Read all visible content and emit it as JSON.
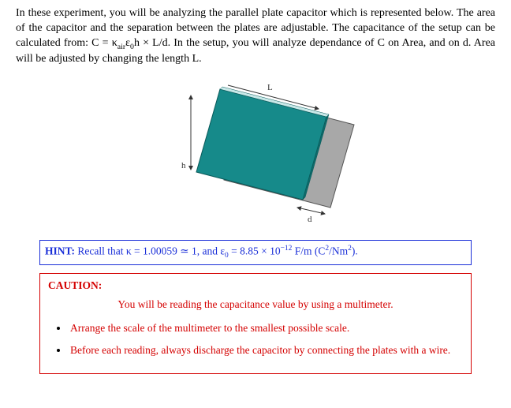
{
  "intro": {
    "text": "In these experiment, you will be analyzing the parallel plate capacitor which is represented below. The area of the capacitor and the separation between the plates are adjustable. The capacitance of the setup can be calculated from: C = κairε0h × L/d. In the setup, you will analyze dependance of C on Area, and on d. Area will be adjusted by changing the length L.",
    "part1": "In these experiment, you will be analyzing the parallel plate capacitor which is represented below. The area of the capacitor and the separation between the plates are adjustable. The capacitance of the setup can be calculated from: ",
    "formula_C": "C",
    "formula_eq": " = κ",
    "formula_air": "air",
    "formula_eps": "ε",
    "formula_0": "0",
    "formula_rest": "h × L/d",
    "part2": ". In the setup, you will analyze dependance of C on Area, and on d. Area will be adjusted by changing the length L."
  },
  "diagram": {
    "label_L": "L",
    "label_h": "h",
    "label_d": "d"
  },
  "hint": {
    "label": "HINT:",
    "pre": " Recall that κ = 1.00059 ≃ 1, and ε",
    "sub0": "0",
    "mid": " = 8.85 × 10",
    "sup": "−12",
    "post1": " F/m (C",
    "sup2": "2",
    "post2": "/Nm",
    "sup3": "2",
    "post3": ")."
  },
  "caution": {
    "title": "CAUTION:",
    "center": "You will be reading the capacitance value by using a multimeter.",
    "item1": "Arrange the scale of the multimeter to the smallest possible scale.",
    "item2": "Before each reading, always discharge the capacitor by connecting the plates with a wire."
  }
}
